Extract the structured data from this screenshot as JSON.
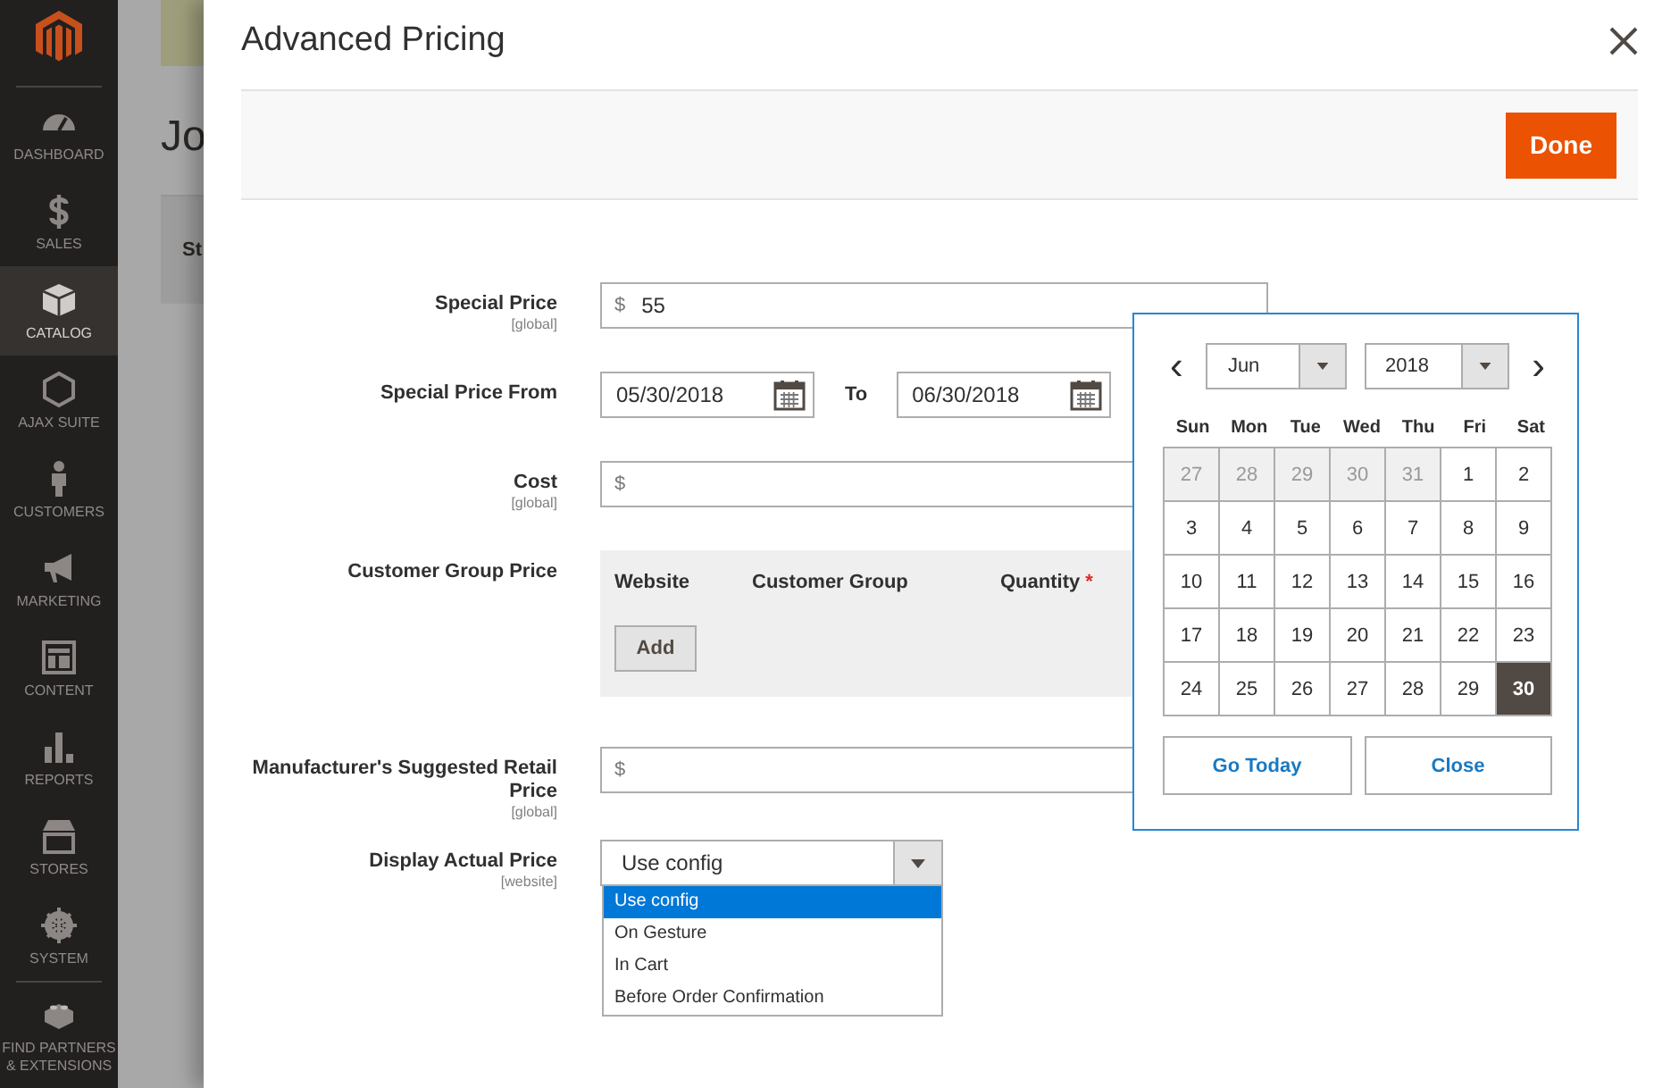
{
  "sidebar": {
    "items": [
      {
        "label": "DASHBOARD",
        "selected": false
      },
      {
        "label": "SALES",
        "selected": false
      },
      {
        "label": "CATALOG",
        "selected": true
      },
      {
        "label": "AJAX SUITE",
        "selected": false
      },
      {
        "label": "CUSTOMERS",
        "selected": false
      },
      {
        "label": "MARKETING",
        "selected": false
      },
      {
        "label": "CONTENT",
        "selected": false
      },
      {
        "label": "REPORTS",
        "selected": false
      },
      {
        "label": "STORES",
        "selected": false
      },
      {
        "label": "SYSTEM",
        "selected": false
      },
      {
        "label": "FIND PARTNERS & EXTENSIONS",
        "selected": false
      }
    ]
  },
  "background_page": {
    "heading": "Jo",
    "column_1": "St"
  },
  "modal": {
    "title": "Advanced Pricing",
    "done_button": "Done",
    "fields": [
      {
        "kind": "price",
        "label": "Special Price",
        "scope": "[global]",
        "currency": "$",
        "value": "55"
      },
      {
        "kind": "date_range",
        "label": "Special Price From",
        "from": "05/30/2018",
        "to_label": "To",
        "to": "06/30/2018"
      },
      {
        "kind": "price",
        "label": "Cost",
        "scope": "[global]",
        "currency": "$"
      },
      {
        "kind": "grid",
        "label": "Customer Group Price",
        "columns": [
          {
            "label": "Website",
            "required": false
          },
          {
            "label": "Customer Group",
            "required": false
          },
          {
            "label": "Quantity",
            "required": true
          }
        ],
        "required_mark": "*",
        "add_button": "Add"
      },
      {
        "kind": "price",
        "label": "Manufacturer's Suggested Retail Price",
        "scope": "[global]",
        "currency": "$"
      },
      {
        "kind": "select",
        "label": "Display Actual Price",
        "scope": "[website]",
        "value": "Use config",
        "options": [
          {
            "label": "Use config",
            "selected": true
          },
          {
            "label": "On Gesture",
            "selected": false
          },
          {
            "label": "In Cart",
            "selected": false
          },
          {
            "label": "Before Order Confirmation",
            "selected": false
          }
        ]
      }
    ],
    "calendar": {
      "prev": "‹",
      "next": "›",
      "month": "Jun",
      "year": "2018",
      "weekdays": [
        "Sun",
        "Mon",
        "Tue",
        "Wed",
        "Thu",
        "Fri",
        "Sat"
      ],
      "weeks": [
        [
          {
            "day": "27",
            "other_month": true,
            "selected": false
          },
          {
            "day": "28",
            "other_month": true,
            "selected": false
          },
          {
            "day": "29",
            "other_month": true,
            "selected": false
          },
          {
            "day": "30",
            "other_month": true,
            "selected": false
          },
          {
            "day": "31",
            "other_month": true,
            "selected": false
          },
          {
            "day": "1",
            "other_month": false,
            "selected": false
          },
          {
            "day": "2",
            "other_month": false,
            "selected": false
          }
        ],
        [
          {
            "day": "3",
            "other_month": false,
            "selected": false
          },
          {
            "day": "4",
            "other_month": false,
            "selected": false
          },
          {
            "day": "5",
            "other_month": false,
            "selected": false
          },
          {
            "day": "6",
            "other_month": false,
            "selected": false
          },
          {
            "day": "7",
            "other_month": false,
            "selected": false
          },
          {
            "day": "8",
            "other_month": false,
            "selected": false
          },
          {
            "day": "9",
            "other_month": false,
            "selected": false
          }
        ],
        [
          {
            "day": "10",
            "other_month": false,
            "selected": false
          },
          {
            "day": "11",
            "other_month": false,
            "selected": false
          },
          {
            "day": "12",
            "other_month": false,
            "selected": false
          },
          {
            "day": "13",
            "other_month": false,
            "selected": false
          },
          {
            "day": "14",
            "other_month": false,
            "selected": false
          },
          {
            "day": "15",
            "other_month": false,
            "selected": false
          },
          {
            "day": "16",
            "other_month": false,
            "selected": false
          }
        ],
        [
          {
            "day": "17",
            "other_month": false,
            "selected": false
          },
          {
            "day": "18",
            "other_month": false,
            "selected": false
          },
          {
            "day": "19",
            "other_month": false,
            "selected": false
          },
          {
            "day": "20",
            "other_month": false,
            "selected": false
          },
          {
            "day": "21",
            "other_month": false,
            "selected": false
          },
          {
            "day": "22",
            "other_month": false,
            "selected": false
          },
          {
            "day": "23",
            "other_month": false,
            "selected": false
          }
        ],
        [
          {
            "day": "24",
            "other_month": false,
            "selected": false
          },
          {
            "day": "25",
            "other_month": false,
            "selected": false
          },
          {
            "day": "26",
            "other_month": false,
            "selected": false
          },
          {
            "day": "27",
            "other_month": false,
            "selected": false
          },
          {
            "day": "28",
            "other_month": false,
            "selected": false
          },
          {
            "day": "29",
            "other_month": false,
            "selected": false
          },
          {
            "day": "30",
            "other_month": false,
            "selected": true
          }
        ]
      ],
      "go_today_button": "Go Today",
      "close_button": "Close"
    }
  }
}
